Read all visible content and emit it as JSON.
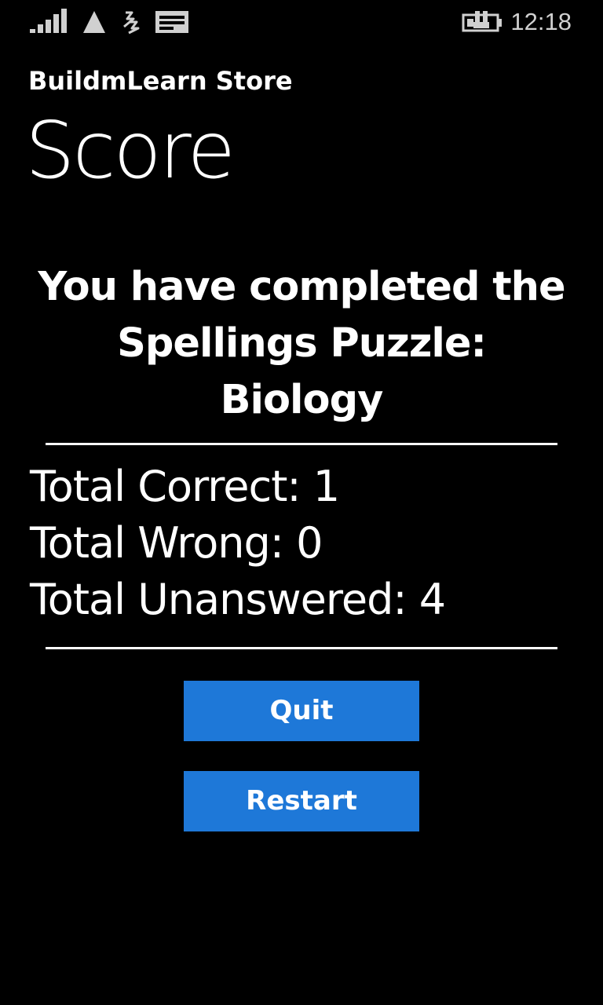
{
  "status_bar": {
    "time": "12:18",
    "icons": [
      "signal-icon",
      "roaming-icon",
      "data-connection-icon",
      "message-icon",
      "battery-charging-icon"
    ]
  },
  "header": {
    "app_title": "BuildmLearn Store",
    "page_title": "Score"
  },
  "completion": {
    "line1": "You have completed the",
    "line2": "Spellings Puzzle:",
    "line3": "Biology"
  },
  "stats": {
    "correct": "Total Correct: 1",
    "wrong": "Total Wrong: 0",
    "unanswered": "Total Unanswered: 4"
  },
  "buttons": {
    "quit": "Quit",
    "restart": "Restart"
  },
  "colors": {
    "background": "#000000",
    "text": "#ffffff",
    "accent": "#1e78d8"
  }
}
